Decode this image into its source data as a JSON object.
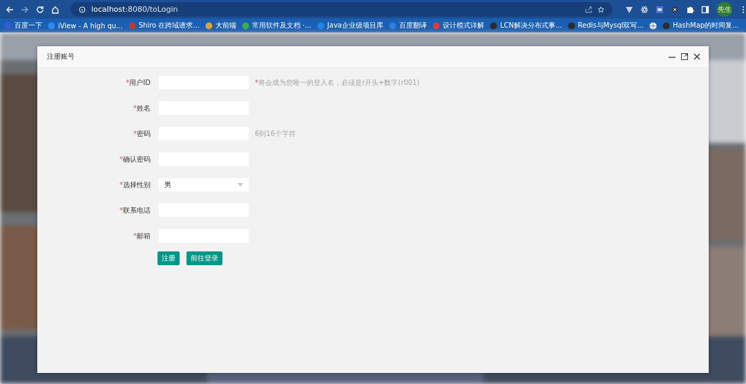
{
  "browser": {
    "url_host": "localhost",
    "url_rest": ":8080/toLogin",
    "avatar": "先生"
  },
  "bookmarks": [
    {
      "label": "百度一下",
      "color": "#3b5bdb"
    },
    {
      "label": "iView - A high qu...",
      "color": "#2d8cf0"
    },
    {
      "label": "Shiro 在跨域请求...",
      "color": "#c0392b"
    },
    {
      "label": "大前端",
      "color": "#d9a441"
    },
    {
      "label": "常用软件及文档 ·...",
      "color": "#3cb043"
    },
    {
      "label": "Java企业级项目库",
      "color": "#1e88e5"
    },
    {
      "label": "百度翻译",
      "color": "#2f7de1"
    },
    {
      "label": "设计模式详解",
      "color": "#e03c31"
    },
    {
      "label": "LCN解决分布式事...",
      "color": "#2b2b2b"
    },
    {
      "label": "Redis与Mysql双写...",
      "color": "#2b2b2b"
    },
    {
      "color": "#ffffff"
    },
    {
      "label": "HashMap的时间复...",
      "color": "#2b2b2b"
    }
  ],
  "dialog": {
    "title": "注册账号"
  },
  "form": [
    {
      "kind": "input",
      "mark": "*",
      "label": "用户ID",
      "hint": {
        "mark": "*",
        "text": "将会成为您唯一的登入名，必须是r开头+数字(r001)"
      }
    },
    {
      "kind": "input",
      "mark": "*",
      "label": "姓名"
    },
    {
      "kind": "input",
      "mark": "*",
      "label": "密码",
      "hint": {
        "text": "6到16个字符"
      }
    },
    {
      "kind": "input",
      "mark": "*",
      "label": "确认密码"
    },
    {
      "kind": "select",
      "mark": "*",
      "label": "选择性别",
      "value": "男"
    },
    {
      "kind": "input",
      "mark": "*",
      "label": "联系电话"
    },
    {
      "kind": "input",
      "mark": "*",
      "label": "邮箱"
    }
  ],
  "buttons": [
    "注册",
    "前往登录"
  ]
}
